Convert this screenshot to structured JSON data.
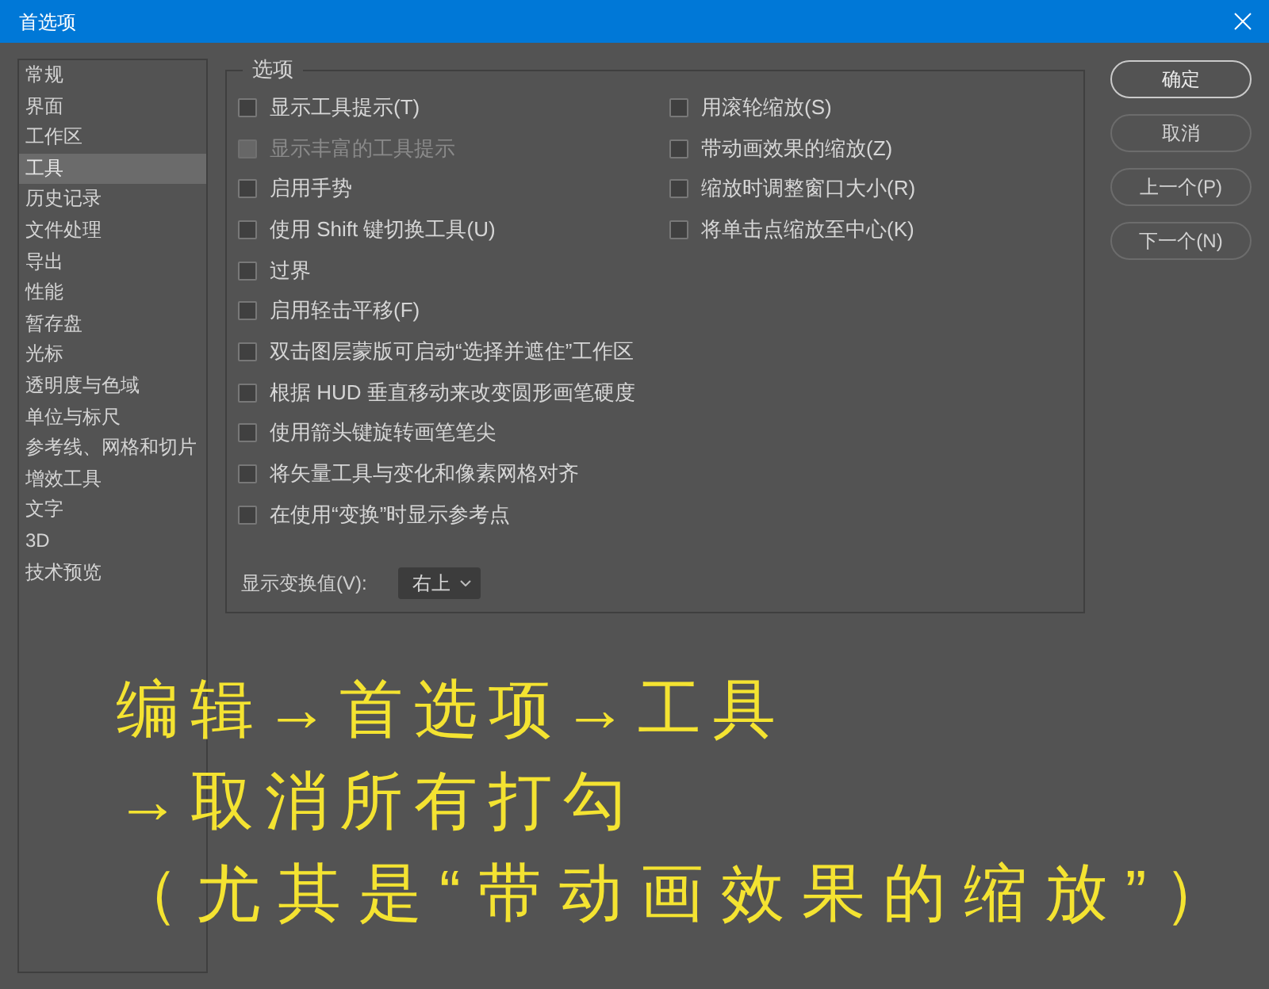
{
  "window": {
    "title": "首选项"
  },
  "sidebar": {
    "items": [
      {
        "label": "常规",
        "selected": false
      },
      {
        "label": "界面",
        "selected": false
      },
      {
        "label": "工作区",
        "selected": false
      },
      {
        "label": "工具",
        "selected": true
      },
      {
        "label": "历史记录",
        "selected": false
      },
      {
        "label": "文件处理",
        "selected": false
      },
      {
        "label": "导出",
        "selected": false
      },
      {
        "label": "性能",
        "selected": false
      },
      {
        "label": "暂存盘",
        "selected": false
      },
      {
        "label": "光标",
        "selected": false
      },
      {
        "label": "透明度与色域",
        "selected": false
      },
      {
        "label": "单位与标尺",
        "selected": false
      },
      {
        "label": "参考线、网格和切片",
        "selected": false
      },
      {
        "label": "增效工具",
        "selected": false
      },
      {
        "label": "文字",
        "selected": false
      },
      {
        "label": "3D",
        "selected": false
      },
      {
        "label": "技术预览",
        "selected": false
      }
    ]
  },
  "options": {
    "title": "选项",
    "left_column": [
      {
        "label": "显示工具提示(T)",
        "checked": false,
        "disabled": false
      },
      {
        "label": "显示丰富的工具提示",
        "checked": false,
        "disabled": true
      },
      {
        "label": "启用手势",
        "checked": false,
        "disabled": false
      },
      {
        "label": "使用 Shift 键切换工具(U)",
        "checked": false,
        "disabled": false
      },
      {
        "label": "过界",
        "checked": false,
        "disabled": false
      },
      {
        "label": "启用轻击平移(F)",
        "checked": false,
        "disabled": false
      },
      {
        "label": "双击图层蒙版可启动“选择并遮住”工作区",
        "checked": false,
        "disabled": false
      },
      {
        "label": "根据 HUD 垂直移动来改变圆形画笔硬度",
        "checked": false,
        "disabled": false
      },
      {
        "label": "使用箭头键旋转画笔笔尖",
        "checked": false,
        "disabled": false
      },
      {
        "label": "将矢量工具与变化和像素网格对齐",
        "checked": false,
        "disabled": false
      },
      {
        "label": "在使用“变换”时显示参考点",
        "checked": false,
        "disabled": false
      }
    ],
    "right_column": [
      {
        "label": "用滚轮缩放(S)",
        "checked": false,
        "disabled": false
      },
      {
        "label": "带动画效果的缩放(Z)",
        "checked": false,
        "disabled": false
      },
      {
        "label": "缩放时调整窗口大小(R)",
        "checked": false,
        "disabled": false
      },
      {
        "label": "将单击点缩放至中心(K)",
        "checked": false,
        "disabled": false
      }
    ],
    "transform_values": {
      "label": "显示变换值(V):",
      "value": "右上"
    }
  },
  "buttons": [
    {
      "label": "确定",
      "default": true
    },
    {
      "label": "取消",
      "default": false
    },
    {
      "label": "上一个(P)",
      "default": false
    },
    {
      "label": "下一个(N)",
      "default": false
    }
  ],
  "annotation": {
    "lines": [
      "编辑→首选项→工具",
      "→取消所有打勾",
      "（尤其是“带动画效果的缩放”）"
    ]
  }
}
